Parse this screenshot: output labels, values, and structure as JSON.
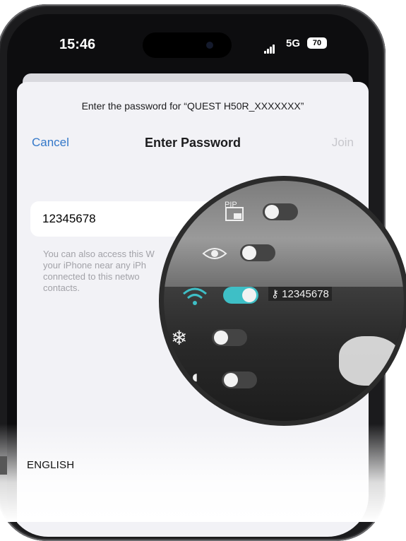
{
  "status_bar": {
    "time": "15:46",
    "network": "5G",
    "battery": "70"
  },
  "dialog": {
    "prompt": "Enter the password for “QUEST H50R_XXXXXXX”",
    "title": "Enter Password",
    "cancel_label": "Cancel",
    "join_label": "Join",
    "password_value": "12345678",
    "hint_lines": [
      "You can also access this W",
      "your iPhone near any iPh",
      "connected to this netwo",
      "contacts."
    ]
  },
  "device_menu": {
    "pip_label": "PIP",
    "wifi_password": "12345678",
    "toggles": [
      {
        "name": "pip",
        "on": false
      },
      {
        "name": "display",
        "on": false
      },
      {
        "name": "wifi",
        "on": true
      },
      {
        "name": "cooling",
        "on": false
      },
      {
        "name": "other",
        "on": false
      }
    ]
  },
  "footer": {
    "language": "ENGLISH"
  },
  "colors": {
    "link_blue": "#3478c9",
    "toggle_on": "#3ebfc6",
    "disabled_gray": "#c7c7cc"
  }
}
